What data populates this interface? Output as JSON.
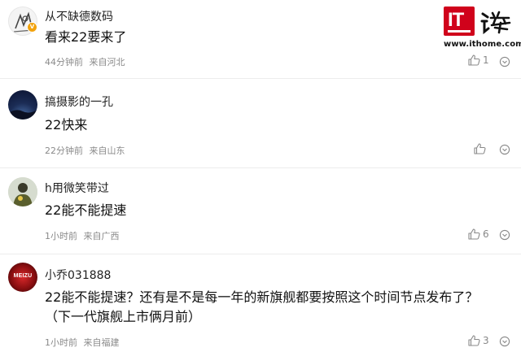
{
  "watermark": {
    "logo_text": "IT",
    "brand_char": "之家",
    "url": "www.ithome.com"
  },
  "comments": [
    {
      "username": "从不缺德数码",
      "verified": true,
      "content": "看来22要来了",
      "time": "44分钟前",
      "location": "来自河北",
      "likes": "1"
    },
    {
      "username": "搞摄影的一孔",
      "verified": false,
      "content": "22快来",
      "time": "22分钟前",
      "location": "来自山东",
      "likes": ""
    },
    {
      "username": "h用微笑带过",
      "verified": false,
      "content": "22能不能提速",
      "time": "1小时前",
      "location": "来自广西",
      "likes": "6"
    },
    {
      "username": "小乔031888",
      "verified": false,
      "content_lines": [
        "22能不能提速？还有是不是每一年的新旗舰都要按照这个时间节点发布了？",
        "（下一代旗舰上市俩月前）"
      ],
      "avatar_text": "MEIZU",
      "time": "1小时前",
      "location": "来自福建",
      "likes": "3"
    }
  ],
  "icons": {
    "like": "thumbs-up-icon",
    "more": "more-options-icon",
    "verified": "verified-badge-icon"
  },
  "colors": {
    "text_primary": "#111111",
    "text_meta": "#8a8a8a",
    "verified_badge": "#f2a20c",
    "brand_red": "#d0021b"
  }
}
